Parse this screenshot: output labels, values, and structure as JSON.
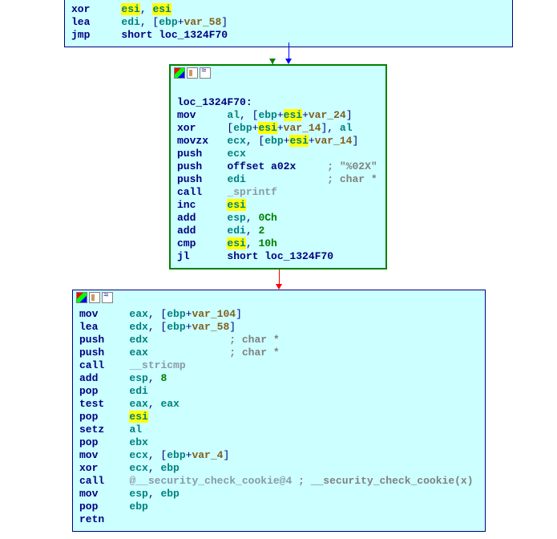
{
  "chart_data": {
    "type": "flowgraph",
    "nodes": [
      "block_top",
      "block_loop",
      "block_bottom"
    ],
    "edges": [
      {
        "from": "block_top",
        "to": "block_loop",
        "kind": "fallthrough",
        "color": "blue"
      },
      {
        "from": "block_loop",
        "to": "block_loop",
        "kind": "true",
        "color": "green"
      },
      {
        "from": "block_loop",
        "to": "block_bottom",
        "kind": "false",
        "color": "red"
      }
    ]
  },
  "block_top": {
    "l0": {
      "mn": "xor",
      "r1": "esi",
      "sep": ", ",
      "r2": "esi"
    },
    "l1": {
      "mn": "lea",
      "r1": "edi",
      "sep": ", [",
      "r2": "ebp",
      "plus": "+",
      "var": "var_58",
      "close": "]"
    },
    "l2": {
      "mn": "jmp",
      "t": "short loc_1324F70"
    }
  },
  "block_loop": {
    "label": "loc_1324F70:",
    "l0": {
      "mn": "mov",
      "r1": "al",
      "sep": ", [",
      "r2": "ebp",
      "plus1": "+",
      "r3": "esi",
      "plus2": "+",
      "var": "var_24",
      "close": "]"
    },
    "l1": {
      "mn": "xor",
      "open": "[",
      "r1": "ebp",
      "plus1": "+",
      "r2": "esi",
      "plus2": "+",
      "var": "var_14",
      "close": "], ",
      "r3": "al"
    },
    "l2": {
      "mn": "movzx",
      "r1": "ecx",
      "sep": ", [",
      "r2": "ebp",
      "plus1": "+",
      "r3": "esi",
      "plus2": "+",
      "var": "var_14",
      "close": "]"
    },
    "l3": {
      "mn": "push",
      "r1": "ecx"
    },
    "l4": {
      "mn": "push",
      "t": "offset a02x",
      "cmt": "; \"%02X\""
    },
    "l5": {
      "mn": "push",
      "r1": "edi",
      "cmt": "; char *"
    },
    "l6": {
      "mn": "call",
      "t": "_sprintf"
    },
    "l7": {
      "mn": "inc",
      "r1": "esi"
    },
    "l8": {
      "mn": "add",
      "r1": "esp",
      "sep": ", ",
      "n": "0Ch"
    },
    "l9": {
      "mn": "add",
      "r1": "edi",
      "sep": ", ",
      "n": "2"
    },
    "l10": {
      "mn": "cmp",
      "r1": "esi",
      "sep": ", ",
      "n": "10h"
    },
    "l11": {
      "mn": "jl",
      "t": "short loc_1324F70"
    }
  },
  "block_bot": {
    "l0": {
      "mn": "mov",
      "r1": "eax",
      "sep": ", [",
      "r2": "ebp",
      "plus": "+",
      "var": "var_104",
      "close": "]"
    },
    "l1": {
      "mn": "lea",
      "r1": "edx",
      "sep": ", [",
      "r2": "ebp",
      "plus": "+",
      "var": "var_58",
      "close": "]"
    },
    "l2": {
      "mn": "push",
      "r1": "edx",
      "cmt": "; char *"
    },
    "l3": {
      "mn": "push",
      "r1": "eax",
      "cmt": "; char *"
    },
    "l4": {
      "mn": "call",
      "t": "__stricmp"
    },
    "l5": {
      "mn": "add",
      "r1": "esp",
      "sep": ", ",
      "n": "8"
    },
    "l6": {
      "mn": "pop",
      "r1": "edi"
    },
    "l7": {
      "mn": "test",
      "r1": "eax",
      "sep": ", ",
      "r2": "eax"
    },
    "l8": {
      "mn": "pop",
      "r1": "esi"
    },
    "l9": {
      "mn": "setz",
      "r1": "al"
    },
    "l10": {
      "mn": "pop",
      "r1": "ebx"
    },
    "l11": {
      "mn": "mov",
      "r1": "ecx",
      "sep": ", [",
      "r2": "ebp",
      "plus": "+",
      "var": "var_4",
      "close": "]"
    },
    "l12": {
      "mn": "xor",
      "r1": "ecx",
      "sep": ", ",
      "r2": "ebp"
    },
    "l13": {
      "mn": "call",
      "t": "@__security_check_cookie@4",
      "cmt": " ; __security_check_cookie(x)"
    },
    "l14": {
      "mn": "mov",
      "r1": "esp",
      "sep": ", ",
      "r2": "ebp"
    },
    "l15": {
      "mn": "pop",
      "r1": "ebp"
    },
    "l16": {
      "mn": "retn"
    }
  }
}
